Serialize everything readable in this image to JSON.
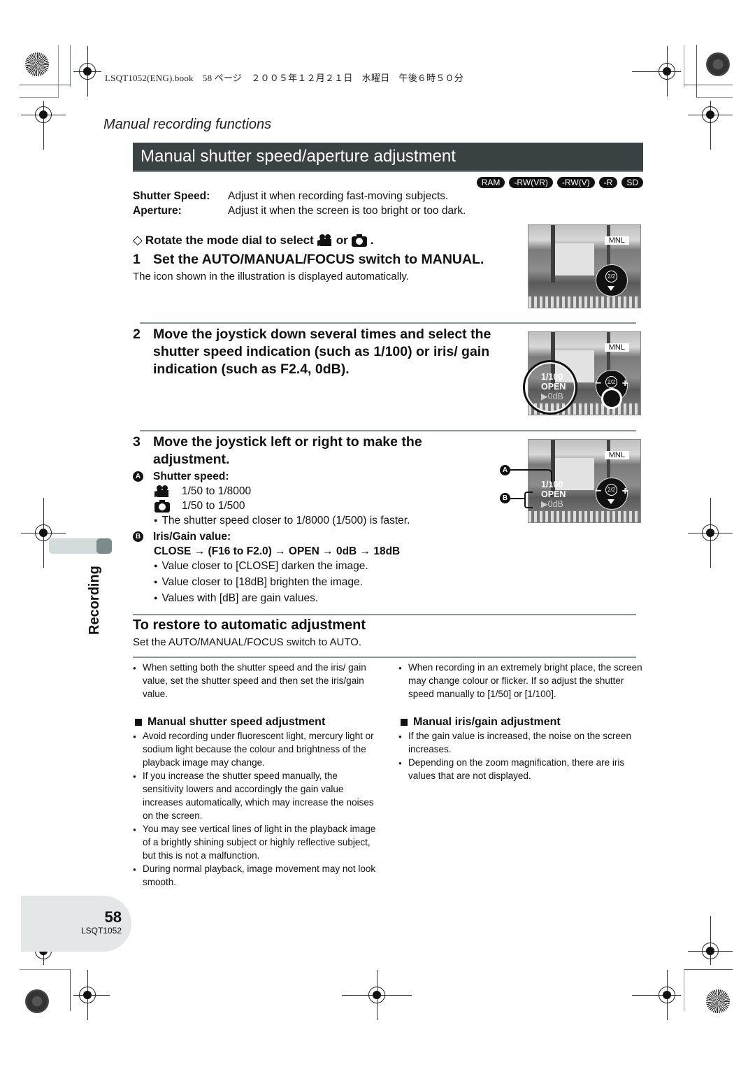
{
  "print_header": "LSQT1052(ENG).book　58 ページ　２００５年１２月２１日　水曜日　午後６時５０分",
  "section_label": "Manual recording functions",
  "title": "Manual shutter speed/aperture adjustment",
  "media_badges": [
    "RAM",
    "-RW(VR)",
    "-RW(V)",
    "-R",
    "SD"
  ],
  "definitions": [
    {
      "term": "Shutter Speed:",
      "desc": "Adjust it when recording fast-moving subjects."
    },
    {
      "term": "Aperture:",
      "desc": "Adjust it when the screen is too bright or too dark."
    }
  ],
  "pre_step": {
    "text": "Rotate the mode dial to select",
    "or": "or",
    "end": ".",
    "icons": [
      "video-camera-icon",
      "still-camera-icon"
    ]
  },
  "steps": [
    {
      "num": "1",
      "text": "Set the AUTO/MANUAL/FOCUS switch to MANUAL.",
      "note": "The icon shown in the illustration is displayed automatically."
    },
    {
      "num": "2",
      "text": "Move the joystick down several times and select the shutter speed indication (such as 1/100) or iris/ gain indication (such as F2.4, 0dB)."
    },
    {
      "num": "3",
      "text": "Move the joystick left or right to make the adjustment."
    }
  ],
  "screens": {
    "mnl": "MNL",
    "shutter": "1/100",
    "iris": "OPEN",
    "gain": "▶0dB",
    "joystick_center": "2/2",
    "minus": "−",
    "plus": "+"
  },
  "callouts": {
    "a": "A",
    "b": "B"
  },
  "shutter_speed": {
    "label": "Shutter speed:",
    "video_range": "1/50 to 1/8000",
    "photo_range": "1/50 to 1/500",
    "note": "The shutter speed closer to 1/8000 (1/500) is faster."
  },
  "iris_gain": {
    "label": "Iris/Gain value:",
    "sequence": "CLOSE → (F16 to F2.0) → OPEN → 0dB → 18dB",
    "notes": [
      "Value closer to [CLOSE] darken the image.",
      "Value closer to [18dB] brighten the image.",
      "Values with [dB] are gain values."
    ]
  },
  "side_tab": "Recording",
  "restore": {
    "heading": "To restore to automatic adjustment",
    "text": "Set the AUTO/MANUAL/FOCUS switch to AUTO."
  },
  "general_notes": [
    "When setting both the shutter speed and the iris/ gain value, set the shutter speed and then set the iris/gain value.",
    "When recording in an extremely bright place, the screen may change colour or flicker. If so adjust the shutter speed manually to [1/50] or [1/100]."
  ],
  "shutter_adjust": {
    "heading": "Manual shutter speed adjustment",
    "items": [
      "Avoid recording under fluorescent light, mercury light or sodium light because the colour and brightness of the playback image may change.",
      "If you increase the shutter speed manually, the sensitivity lowers and accordingly the gain value increases automatically, which may increase the noises on the screen.",
      "You may see vertical lines of light in the playback image of a brightly shining subject or highly reflective subject, but this is not a malfunction.",
      "During normal playback, image movement may not look smooth."
    ]
  },
  "iris_adjust": {
    "heading": "Manual iris/gain adjustment",
    "items": [
      "If the gain value is increased, the noise on the screen increases.",
      "Depending on the zoom magnification, there are iris values that are not displayed."
    ]
  },
  "footer": {
    "page": "58",
    "code": "LSQT1052"
  }
}
